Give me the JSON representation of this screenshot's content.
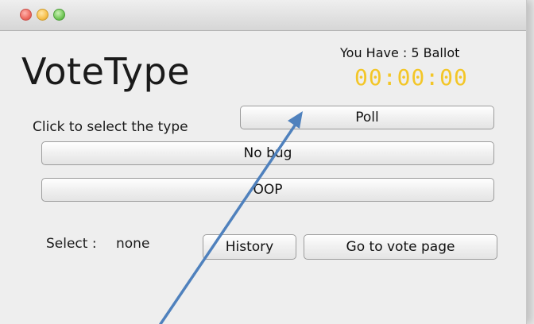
{
  "window": {
    "controls": [
      "close",
      "minimize",
      "zoom"
    ]
  },
  "app": {
    "title": "VoteType",
    "ballot_text": "You Have : 5 Ballot",
    "timer": "00:00:00",
    "prompt": "Click to select the type"
  },
  "buttons": {
    "poll": "Poll",
    "no_bug": "No bug",
    "oop": "OOP",
    "history": "History",
    "go_to_vote": "Go to vote page"
  },
  "selection": {
    "label": "Select :",
    "value": "none"
  },
  "colors": {
    "timer": "#f3c627",
    "annotation_arrow": "#4f81bd"
  },
  "annotation": {
    "type": "arrow",
    "color": "#4f81bd"
  }
}
